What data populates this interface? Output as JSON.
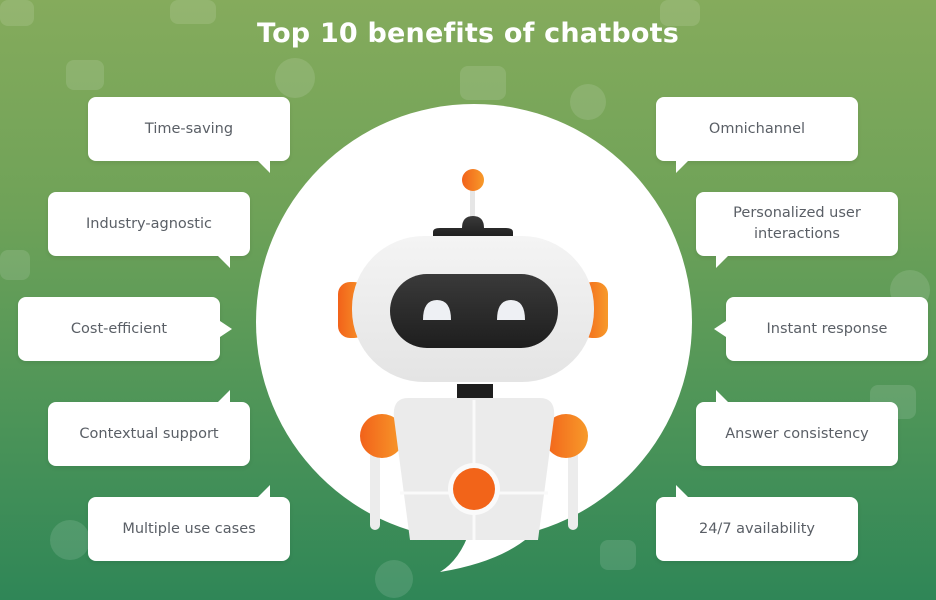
{
  "title": "Top 10 benefits of chatbots",
  "colors": {
    "bg_top": "#85ab5c",
    "bg_bottom": "#2f8657",
    "bubble": "#ffffff",
    "bubble_text": "#5a5f66",
    "accent_orange": "#f26a1b",
    "robot_dark": "#2a2a2a"
  },
  "benefits": {
    "left": [
      {
        "label": "Time-saving"
      },
      {
        "label": "Industry-agnostic"
      },
      {
        "label": "Cost-efficient"
      },
      {
        "label": "Contextual support"
      },
      {
        "label": "Multiple use cases"
      }
    ],
    "right": [
      {
        "label": "Omnichannel"
      },
      {
        "label": "Personalized user interactions"
      },
      {
        "label": "Instant response"
      },
      {
        "label": "Answer consistency"
      },
      {
        "label": "24/7 availability"
      }
    ]
  },
  "illustration": {
    "subject": "chatbot-robot"
  }
}
